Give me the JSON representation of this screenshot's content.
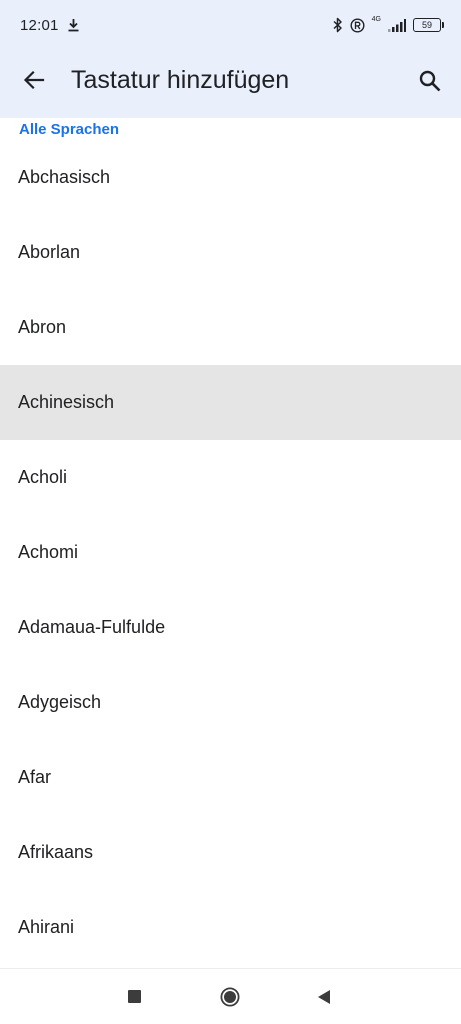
{
  "status_bar": {
    "time": "12:01",
    "network_label": "4G",
    "battery_level": "59",
    "icons": [
      "download-icon",
      "bluetooth-icon",
      "registered-icon",
      "signal-icon",
      "battery-icon"
    ]
  },
  "app_bar": {
    "title": "Tastatur hinzufügen",
    "back_icon": "arrow-back-icon",
    "search_icon": "search-icon"
  },
  "section": {
    "header": "Alle Sprachen"
  },
  "languages": [
    {
      "label": "Abchasisch"
    },
    {
      "label": "Aborlan"
    },
    {
      "label": "Abron"
    },
    {
      "label": "Achinesisch"
    },
    {
      "label": "Acholi"
    },
    {
      "label": "Achomi"
    },
    {
      "label": "Adamaua-Fulfulde"
    },
    {
      "label": "Adygeisch"
    },
    {
      "label": "Afar"
    },
    {
      "label": "Afrikaans"
    },
    {
      "label": "Ahirani"
    }
  ],
  "highlighted_language": "Achinesisch",
  "colors": {
    "app_bar_bg": "#e9f0fb",
    "accent": "#1a73e8",
    "highlight_bg": "#e5e5e5",
    "text": "#202124"
  },
  "nav_bar": {
    "icons": [
      "recent-apps-icon",
      "home-icon",
      "back-triangle-icon"
    ]
  }
}
